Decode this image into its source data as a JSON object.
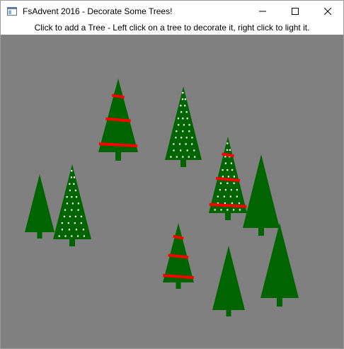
{
  "window": {
    "title": "FsAdvent 2016 - Decorate Some Trees!",
    "icon": "app-window-icon",
    "controls": [
      "minimize-icon",
      "maximize-icon",
      "close-icon"
    ]
  },
  "instruction": "Click to add a Tree - Left click on a tree to decorate it, right click to light it.",
  "colors": {
    "canvas_bg": "#808080",
    "tree": "#006400",
    "light": "#ffffff",
    "ribbon": "#ff0000"
  },
  "trees": [
    {
      "id": "tree-1",
      "decorated": true,
      "lit": false
    },
    {
      "id": "tree-2",
      "decorated": false,
      "lit": true
    },
    {
      "id": "tree-3",
      "decorated": false,
      "lit": false
    },
    {
      "id": "tree-4",
      "decorated": false,
      "lit": true
    },
    {
      "id": "tree-5",
      "decorated": true,
      "lit": true
    },
    {
      "id": "tree-6",
      "decorated": false,
      "lit": false
    },
    {
      "id": "tree-7",
      "decorated": true,
      "lit": false
    },
    {
      "id": "tree-8",
      "decorated": false,
      "lit": false
    },
    {
      "id": "tree-9",
      "decorated": false,
      "lit": false
    }
  ]
}
